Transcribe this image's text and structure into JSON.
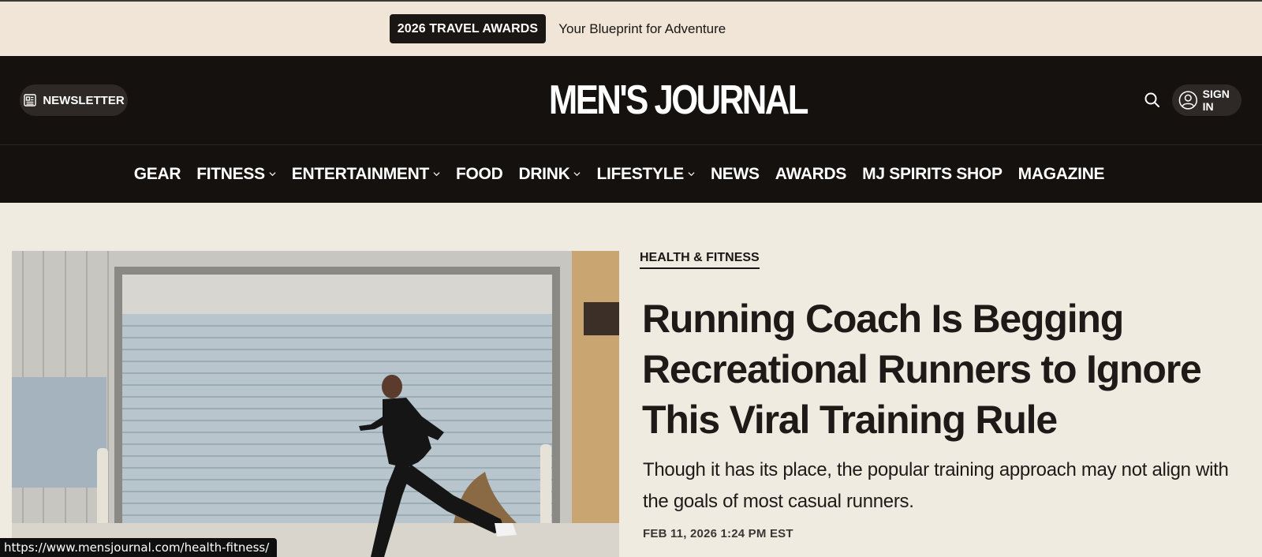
{
  "promo": {
    "badge": "2026 TRAVEL AWARDS",
    "text": "Your Blueprint for Adventure"
  },
  "header": {
    "newsletter_label": "NEWSLETTER",
    "logo_text": "MEN'S JOURNAL",
    "signin_label": "SIGN IN"
  },
  "nav": {
    "items": [
      {
        "label": "GEAR",
        "has_dropdown": false
      },
      {
        "label": "FITNESS",
        "has_dropdown": true
      },
      {
        "label": "ENTERTAINMENT",
        "has_dropdown": true
      },
      {
        "label": "FOOD",
        "has_dropdown": false
      },
      {
        "label": "DRINK",
        "has_dropdown": true
      },
      {
        "label": "LIFESTYLE",
        "has_dropdown": true
      },
      {
        "label": "NEWS",
        "has_dropdown": false
      },
      {
        "label": "AWARDS",
        "has_dropdown": false
      },
      {
        "label": "MJ SPIRITS SHOP",
        "has_dropdown": false
      },
      {
        "label": "MAGAZINE",
        "has_dropdown": false
      }
    ]
  },
  "article": {
    "category": "HEALTH & FITNESS",
    "headline": "Running Coach Is Begging Recreational Runners to Ignore This Viral Training Rule",
    "dek": "Though it has its place, the popular training approach may not align with the goals of most casual runners.",
    "timestamp": "FEB 11, 2026 1:24 PM EST"
  },
  "status_bar": {
    "url": "https://www.mensjournal.com/health-fitness/"
  },
  "colors": {
    "header_bg": "#15110f",
    "page_bg": "#f0ebe1",
    "promo_bg": "#f0e5d6"
  }
}
